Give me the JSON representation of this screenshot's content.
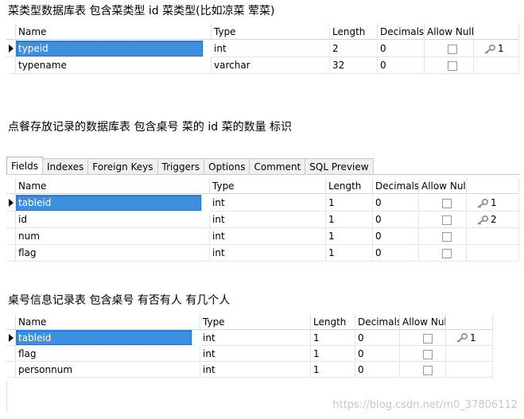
{
  "headings": {
    "h1": "菜类型数据库表  包含菜类型 id  菜类型(比如凉菜  荤菜)",
    "h2": "点餐存放记录的数据库表  包含桌号  菜的 id  菜的数量  标识",
    "h3": "桌号信息记录表  包含桌号  有否有人  有几个人"
  },
  "columns": [
    "Name",
    "Type",
    "Length",
    "Decimals",
    "Allow Null",
    ""
  ],
  "tabs": [
    "Fields",
    "Indexes",
    "Foreign Keys",
    "Triggers",
    "Options",
    "Comment",
    "SQL Preview"
  ],
  "table1": {
    "rows": [
      {
        "name": "typeid",
        "type": "int",
        "length": "2",
        "decimals": "0",
        "key": "1"
      },
      {
        "name": "typename",
        "type": "varchar",
        "length": "32",
        "decimals": "0",
        "key": ""
      }
    ]
  },
  "table2": {
    "rows": [
      {
        "name": "tableid",
        "type": "int",
        "length": "1",
        "decimals": "0",
        "key": "1"
      },
      {
        "name": "id",
        "type": "int",
        "length": "1",
        "decimals": "0",
        "key": "2"
      },
      {
        "name": "num",
        "type": "int",
        "length": "1",
        "decimals": "0",
        "key": ""
      },
      {
        "name": "flag",
        "type": "int",
        "length": "1",
        "decimals": "0",
        "key": ""
      }
    ]
  },
  "table3": {
    "rows": [
      {
        "name": "tableid",
        "type": "int",
        "length": "1",
        "decimals": "0",
        "key": "1"
      },
      {
        "name": "flag",
        "type": "int",
        "length": "1",
        "decimals": "0",
        "key": ""
      },
      {
        "name": "personnum",
        "type": "int",
        "length": "1",
        "decimals": "0",
        "key": ""
      }
    ]
  },
  "watermark": "https://blog.csdn.net/m0_37806112",
  "colors": {
    "selection": "#3d8fe0",
    "key_icon": "#888888"
  }
}
